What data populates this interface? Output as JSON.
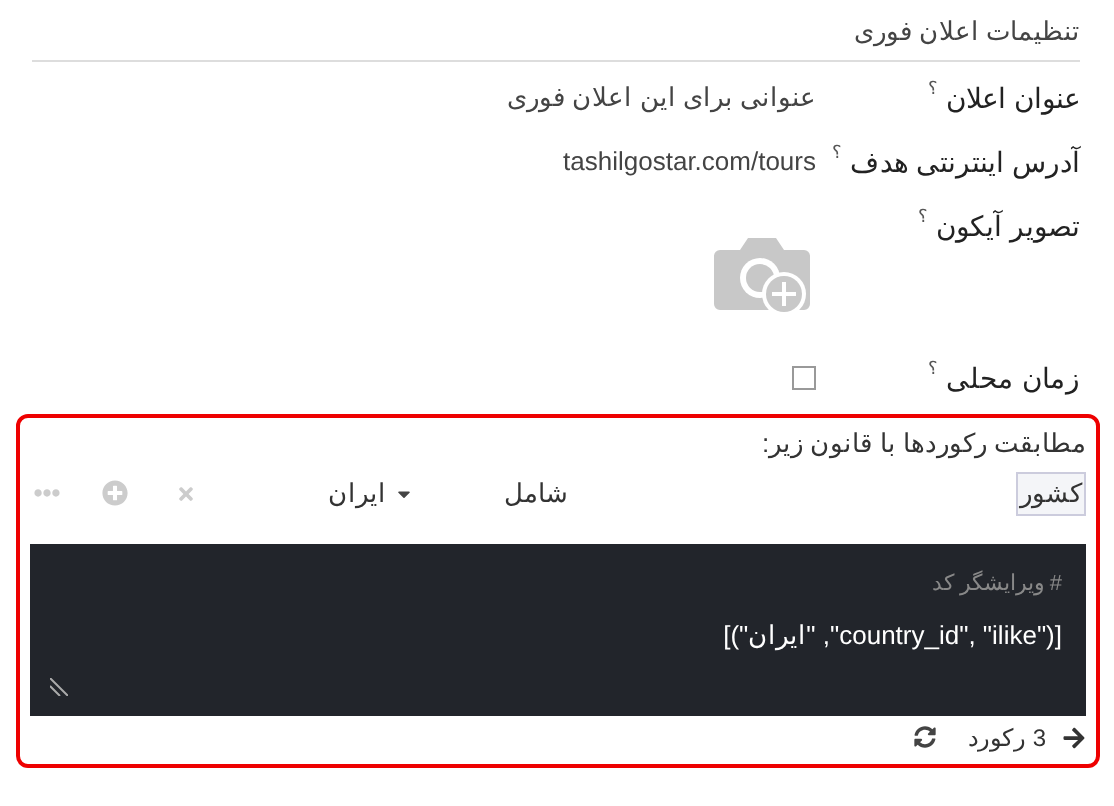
{
  "section_title": "تنظیمات اعلان فوری",
  "fields": [
    {
      "kind": "text",
      "label": "عنوان اعلان",
      "help": "؟",
      "value": "عنوانی برای این اعلان فوری"
    },
    {
      "kind": "text",
      "label": "آدرس اینترنتی هدف",
      "help": "؟",
      "value": "tashilgostar.com/tours"
    },
    {
      "kind": "image",
      "label": "تصویر آیکون",
      "help": "؟"
    },
    {
      "kind": "checkbox",
      "label": "زمان محلی",
      "help": "؟",
      "checked": false
    }
  ],
  "domain": {
    "intro": "مطابقت رکوردها با قانون زیر:",
    "rule": {
      "field": "کشور",
      "operator": "شامل",
      "value": "ایران"
    },
    "code_editor": {
      "comment": "# ویرایشگر کد",
      "code": "[(\"country_id\", \"ilike\", \"ایران\")]"
    },
    "record_count": "3 رکورد"
  }
}
